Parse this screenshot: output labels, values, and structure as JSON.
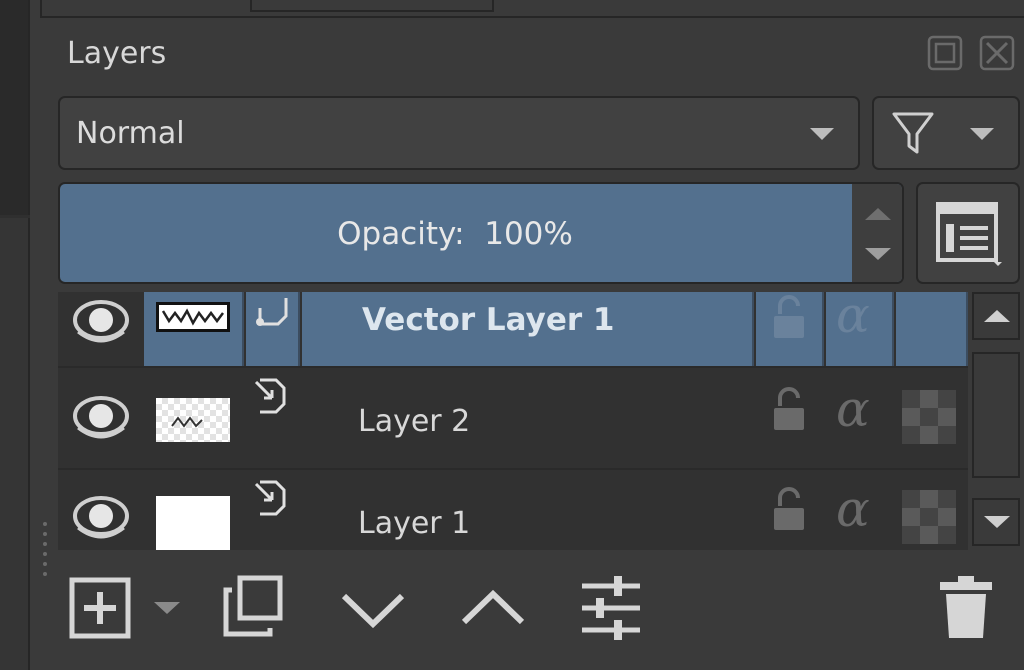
{
  "panel": {
    "title": "Layers",
    "float_button": "float-icon",
    "close_button": "close-icon"
  },
  "blend_mode": {
    "selected": "Normal"
  },
  "filter": {
    "icon": "filter-icon"
  },
  "opacity": {
    "label": "Opacity:  100%"
  },
  "layers": [
    {
      "name": "Vector Layer 1",
      "type": "vector",
      "selected": true,
      "visible": true,
      "thumbnail": "vector-thumbnail"
    },
    {
      "name": "Layer 2",
      "type": "paint",
      "selected": false,
      "visible": true,
      "thumbnail": "checker-thumbnail"
    },
    {
      "name": "Layer 1",
      "type": "paint",
      "selected": false,
      "visible": true,
      "thumbnail": "white-thumbnail"
    }
  ],
  "toolbar": {
    "icons": [
      "add-layer-icon",
      "dropdown-icon",
      "duplicate-layer-icon",
      "move-down-icon",
      "move-up-icon",
      "layer-properties-icon",
      "delete-layer-icon"
    ]
  },
  "colors": {
    "background": "#3a3a3a",
    "selection": "#53708e",
    "list_background": "#313131"
  }
}
